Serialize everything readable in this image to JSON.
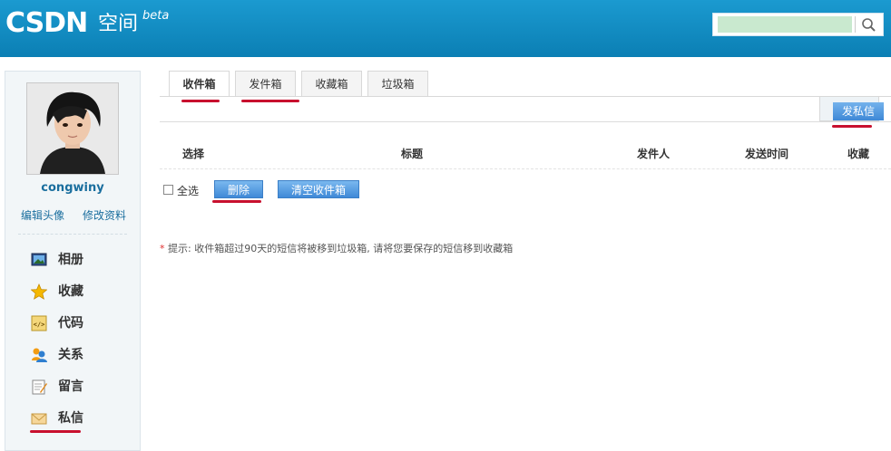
{
  "header": {
    "logo_text": "CSDN",
    "logo_zh": "空间",
    "beta": "beta",
    "search": {
      "value": "",
      "placeholder": ""
    },
    "search_icon": "search-icon",
    "colors": {
      "header_bg": "#0b7fb4",
      "accent": "#3e88d6",
      "underline": "#c8102e"
    }
  },
  "sidebar": {
    "username": "congwiny",
    "edit_avatar": "编辑头像",
    "edit_profile": "修改资料",
    "items": [
      {
        "label": "相册",
        "icon": "photo-album-icon"
      },
      {
        "label": "收藏",
        "icon": "star-icon"
      },
      {
        "label": "代码",
        "icon": "code-icon"
      },
      {
        "label": "关系",
        "icon": "contacts-icon"
      },
      {
        "label": "留言",
        "icon": "note-icon"
      },
      {
        "label": "私信",
        "icon": "envelope-icon"
      }
    ]
  },
  "tabs": [
    {
      "label": "收件箱",
      "active": true
    },
    {
      "label": "发件箱",
      "active": false
    },
    {
      "label": "收藏箱",
      "active": false
    },
    {
      "label": "垃圾箱",
      "active": false
    }
  ],
  "compose_label": "发私信",
  "table": {
    "columns": [
      "选择",
      "标题",
      "发件人",
      "发送时间",
      "收藏"
    ]
  },
  "actions": {
    "select_all": "全选",
    "delete": "删除",
    "clear_inbox": "清空收件箱"
  },
  "tip": {
    "star": "*",
    "text": "提示: 收件箱超过90天的短信将被移到垃圾箱, 请将您要保存的短信移到收藏箱"
  }
}
